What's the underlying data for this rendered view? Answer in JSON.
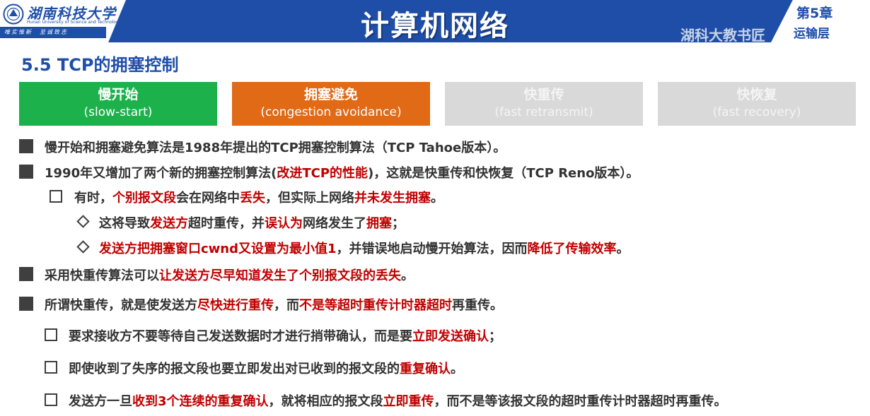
{
  "header": {
    "university_name": "湖南科技大学",
    "university_en": "Hunan University of Science and Technology",
    "motto": "唯实惟新　至诚致志",
    "title": "计算机网络",
    "chapter": "第5章",
    "chapter_sub": "运输层",
    "watermark": "湖科大教书匠"
  },
  "section_title": "5.5 TCP的拥塞控制",
  "phases": [
    {
      "cn": "慢开始",
      "en": "(slow-start)",
      "state": "active",
      "color": "#1db14c"
    },
    {
      "cn": "拥塞避免",
      "en": "(congestion avoidance)",
      "state": "active",
      "color": "#e06a16"
    },
    {
      "cn": "快重传",
      "en": "(fast retransmit)",
      "state": "dimmed",
      "color": "#d9d9d9"
    },
    {
      "cn": "快恢复",
      "en": "(fast recovery)",
      "state": "dimmed",
      "color": "#d9d9d9"
    }
  ],
  "bullets": {
    "b1": {
      "t1": "慢开始和拥塞避免算法是1988年提出的TCP拥塞控制算法（TCP Tahoe版本）。"
    },
    "b2": {
      "t1": "1990年又增加了两个新的拥塞控制算法(",
      "t2": "改进TCP的性能",
      "t3": ")，这就是快重传和快恢复（TCP Reno版本）。"
    },
    "b2a": {
      "t1": "有时，",
      "t2": "个别报文段",
      "t3": "会在网络中",
      "t4": "丢失",
      "t5": "，但实际上网络",
      "t6": "并未发生拥塞",
      "t7": "。"
    },
    "b2a1": {
      "t1": "这将导致",
      "t2": "发送方",
      "t3": "超时重传，并",
      "t4": "误认为",
      "t5": "网络发生了",
      "t6": "拥塞",
      "t7": "；"
    },
    "b2a2": {
      "t1": "发送方把拥塞窗口cwnd又设置为最小值1",
      "t2": "，并错误地启动慢开始算法，因而",
      "t3": "降低了传输效率",
      "t4": "。"
    },
    "b3": {
      "t1": "采用快重传算法可以",
      "t2": "让发送方尽早知道发生了个别报文段的丢失",
      "t3": "。"
    },
    "b4": {
      "t1": "所谓快重传，就是使发送方",
      "t2": "尽快进行重传",
      "t3": "，而",
      "t4": "不是等超时重传计时器超时",
      "t5": "再重传。"
    },
    "b4a": {
      "t1": "要求接收方不要等待自己发送数据时才进行捎带确认，而是要",
      "t2": "立即发送确认",
      "t3": "；"
    },
    "b4b": {
      "t1": "即使收到了失序的报文段也要立即发出对已收到的报文段的",
      "t2": "重复确认",
      "t3": "。"
    },
    "b4c": {
      "t1": "发送方一旦",
      "t2": "收到3个连续的重复确认",
      "t3": "，就将相应的报文段",
      "t4": "立即重传",
      "t5": "，而不是等该报文段的超时重传计时器超时再重传。"
    }
  },
  "colors": {
    "header_blue": "#1f4ea8",
    "emphasis_red": "#c00000",
    "text_dark": "#333333"
  }
}
